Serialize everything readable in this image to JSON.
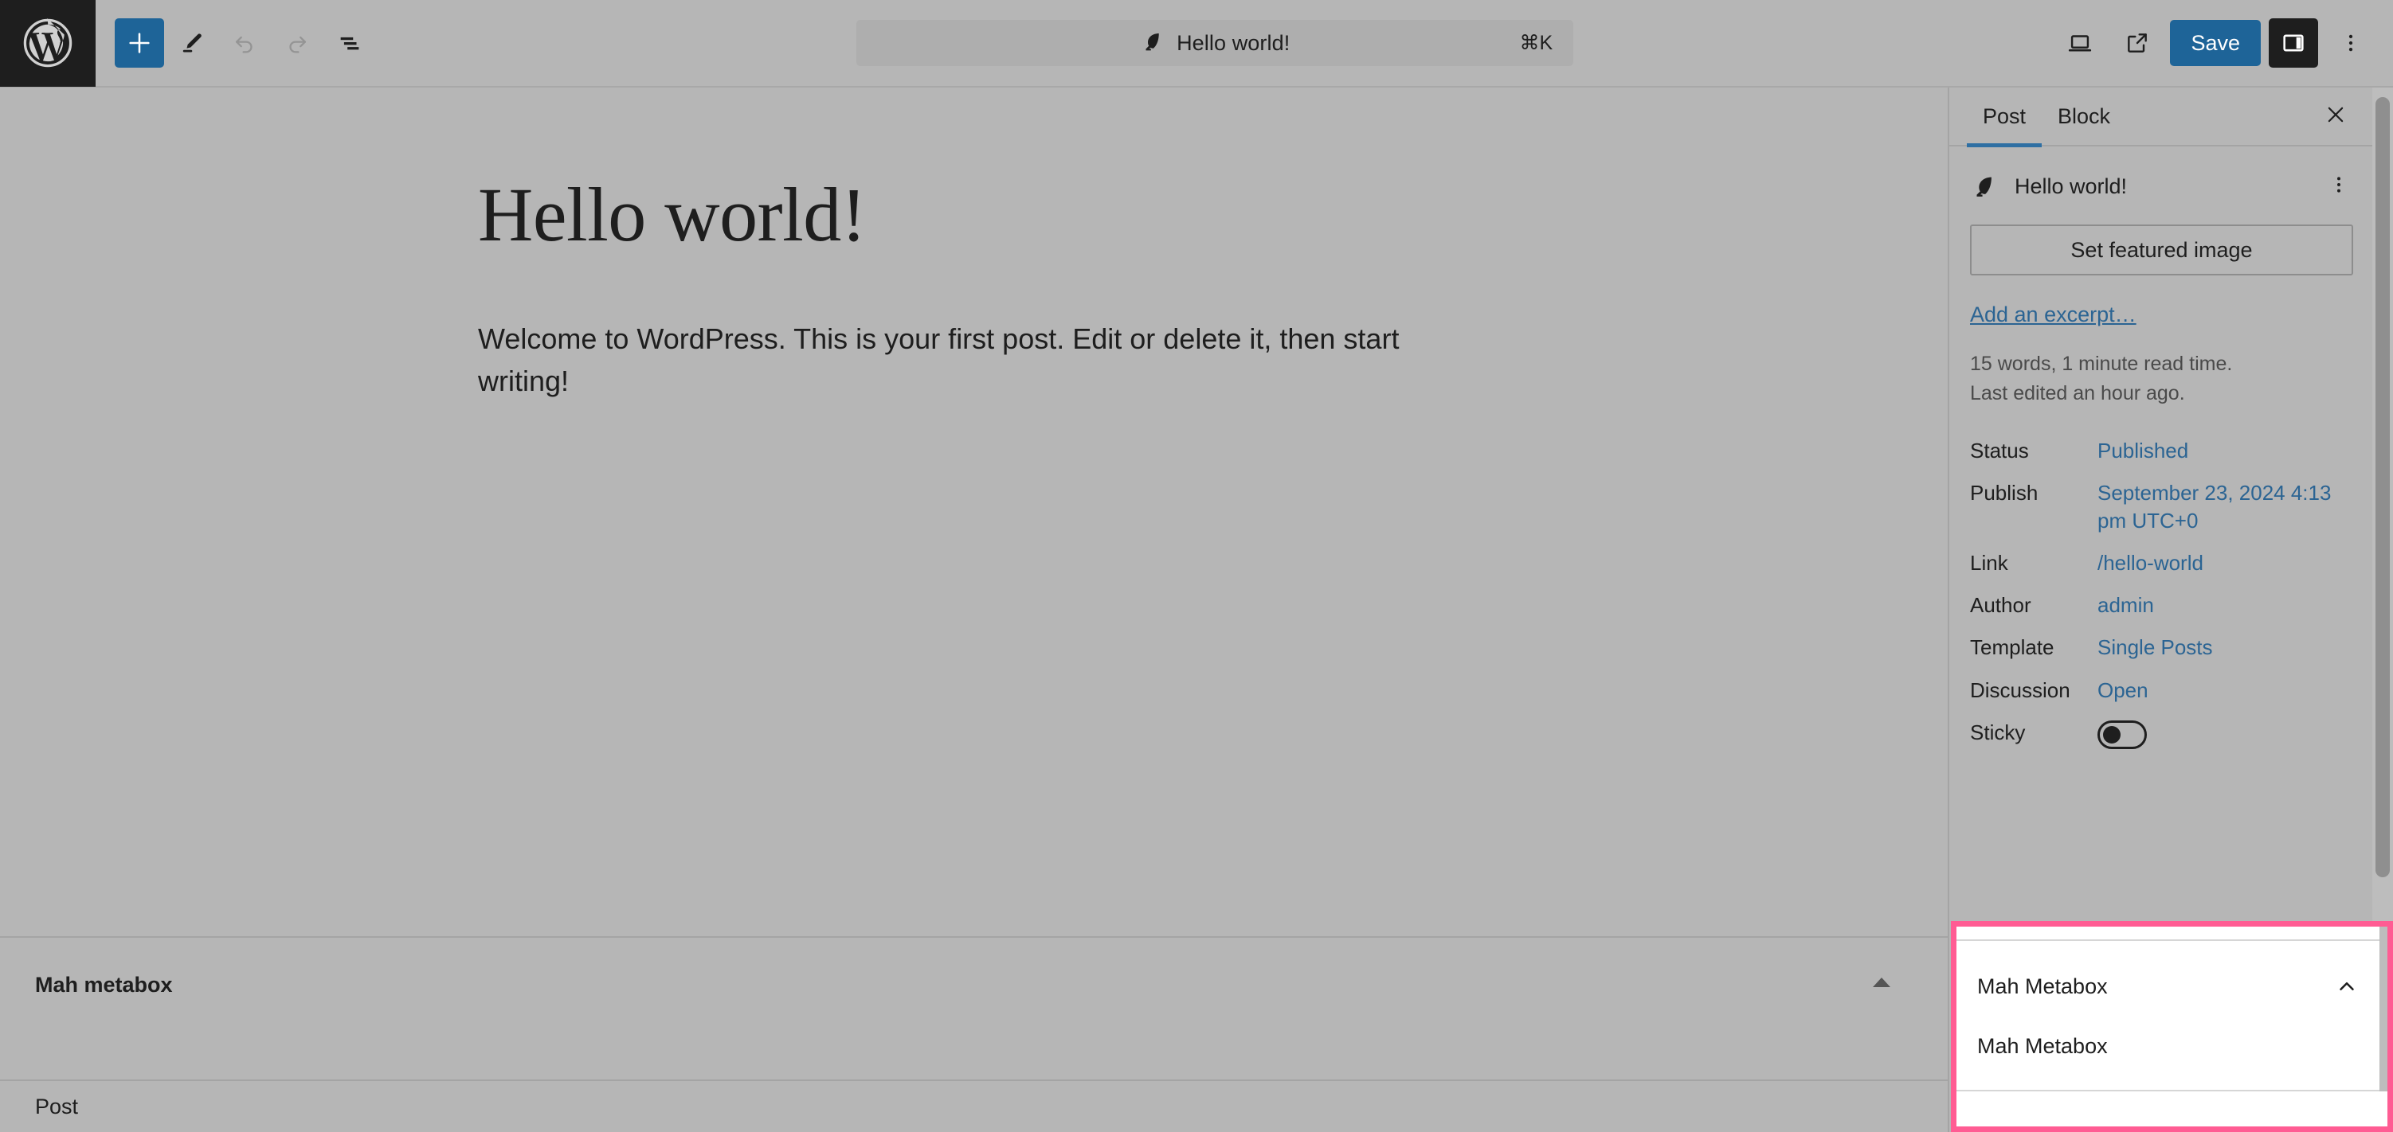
{
  "toolbar": {
    "wordpress_logo_icon": "wordpress-logo-icon",
    "add_block_label": "+",
    "add_block_icon": "plus-icon",
    "tools_icon": "pencil-edit-icon",
    "undo_icon": "undo-arrow-icon",
    "redo_icon": "redo-arrow-icon",
    "list_view_icon": "document-outline-list-view-icon",
    "command_bar": {
      "post_icon": "feather-quill-icon",
      "title": "Hello world!",
      "shortcut": "⌘K"
    },
    "preview_icon": "desktop-preview-icon",
    "view_external_icon": "external-link-icon",
    "save_label": "Save",
    "settings_toggle_icon": "settings-sidebar-toggle-icon",
    "options_icon": "three-dots-vertical-icon",
    "accent_blue": "#1e6498",
    "toggle_active_bg": "#1e1e1e"
  },
  "editor": {
    "post_title": "Hello world!",
    "post_paragraph": "Welcome to WordPress. This is your first post. Edit or delete it, then start writing!"
  },
  "metabox_area": {
    "title": "Mah metabox",
    "collapse_icon": "triangle-up-collapse-icon"
  },
  "footer": {
    "breadcrumb": "Post"
  },
  "sidebar": {
    "tabs": [
      {
        "label": "Post",
        "active": true
      },
      {
        "label": "Block",
        "active": false
      }
    ],
    "close_icon": "close-x-icon",
    "post_card": {
      "icon": "feather-quill-icon",
      "title": "Hello world!",
      "menu_icon": "three-dots-vertical-icon"
    },
    "featured_image_label": "Set featured image",
    "excerpt_link": "Add an excerpt…",
    "read_stats": {
      "words": "15 words, 1 minute read time.",
      "last_edited": "Last edited an hour ago."
    },
    "meta": [
      {
        "label": "Status",
        "value": "Published"
      },
      {
        "label": "Publish",
        "value": "September 23, 2024 4:13 pm UTC+0"
      },
      {
        "label": "Link",
        "value": "/hello-world"
      },
      {
        "label": "Author",
        "value": "admin"
      },
      {
        "label": "Template",
        "value": "Single Posts"
      },
      {
        "label": "Discussion",
        "value": "Open"
      }
    ],
    "sticky": {
      "label": "Sticky",
      "state": "off"
    },
    "link_color": "#2b6493",
    "active_tab_underline": "#2e6fa3"
  },
  "highlight_panel": {
    "header_title": "Mah Metabox",
    "body_text": "Mah Metabox",
    "chevron_icon": "chevron-up-icon",
    "highlight_color": "#ff5c93"
  }
}
